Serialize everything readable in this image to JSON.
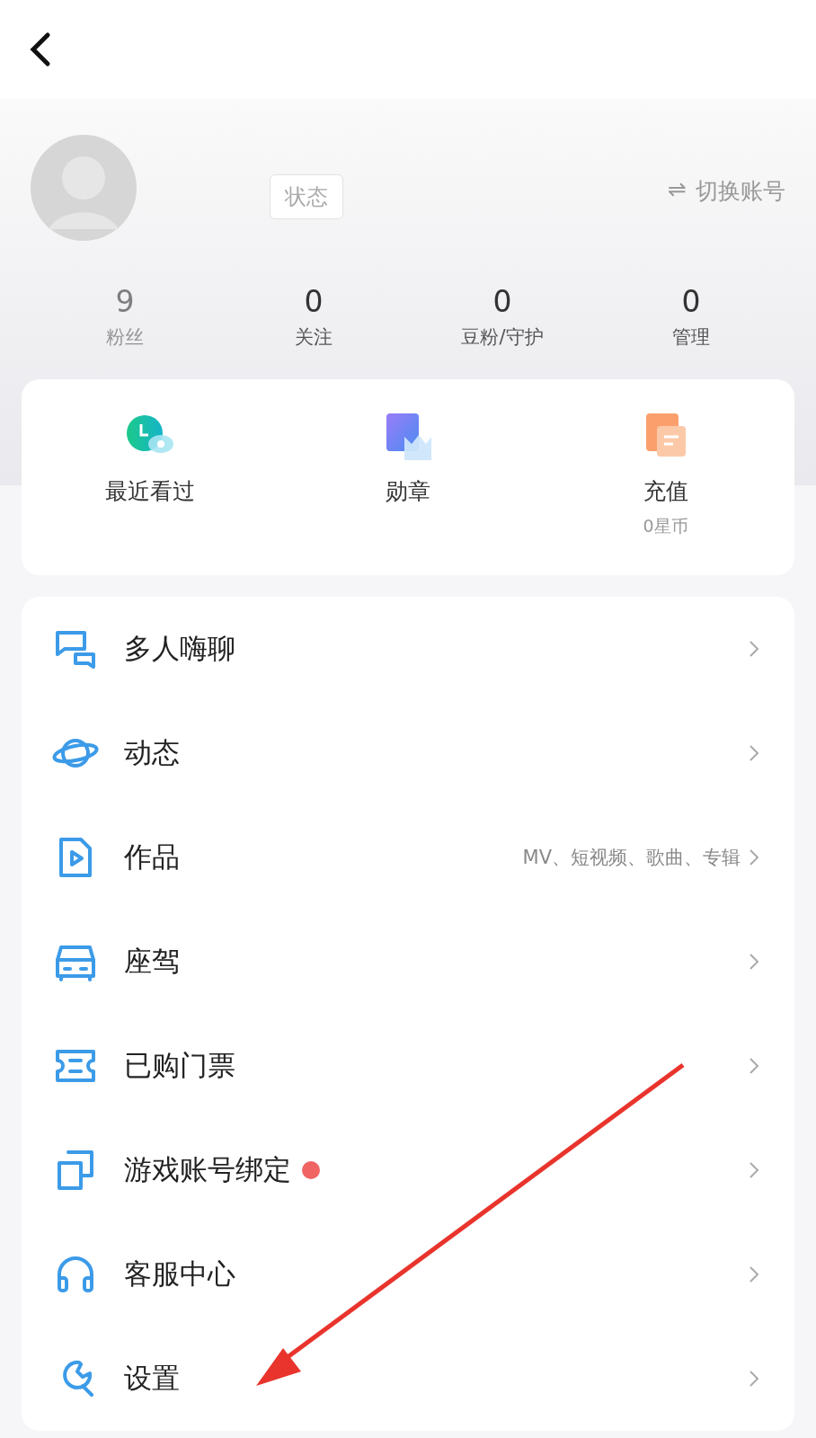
{
  "header": {
    "status_button": "状态",
    "switch_account": {
      "icon": "⇌",
      "label": "切换账号"
    }
  },
  "stats": [
    {
      "value": "9",
      "label": "粉丝",
      "faded": true
    },
    {
      "value": "0",
      "label": "关注",
      "faded": false
    },
    {
      "value": "0",
      "label": "豆粉/守护",
      "faded": false
    },
    {
      "value": "0",
      "label": "管理",
      "faded": false
    }
  ],
  "shortcuts": [
    {
      "kind": "history",
      "label": "最近看过"
    },
    {
      "kind": "medal",
      "label": "勋章"
    },
    {
      "kind": "recharge",
      "label": "充值",
      "sub": "0星币"
    }
  ],
  "menu": [
    {
      "kind": "chat",
      "label": "多人嗨聊",
      "dot": false
    },
    {
      "kind": "planet",
      "label": "动态",
      "dot": false
    },
    {
      "kind": "works",
      "label": "作品",
      "hint": "MV、短视频、歌曲、专辑",
      "dot": false
    },
    {
      "kind": "car",
      "label": "座驾",
      "dot": false
    },
    {
      "kind": "ticket",
      "label": "已购门票",
      "dot": false
    },
    {
      "kind": "game",
      "label": "游戏账号绑定",
      "dot": true
    },
    {
      "kind": "headset",
      "label": "客服中心",
      "dot": false
    },
    {
      "kind": "wrench",
      "label": "设置",
      "dot": false
    }
  ]
}
